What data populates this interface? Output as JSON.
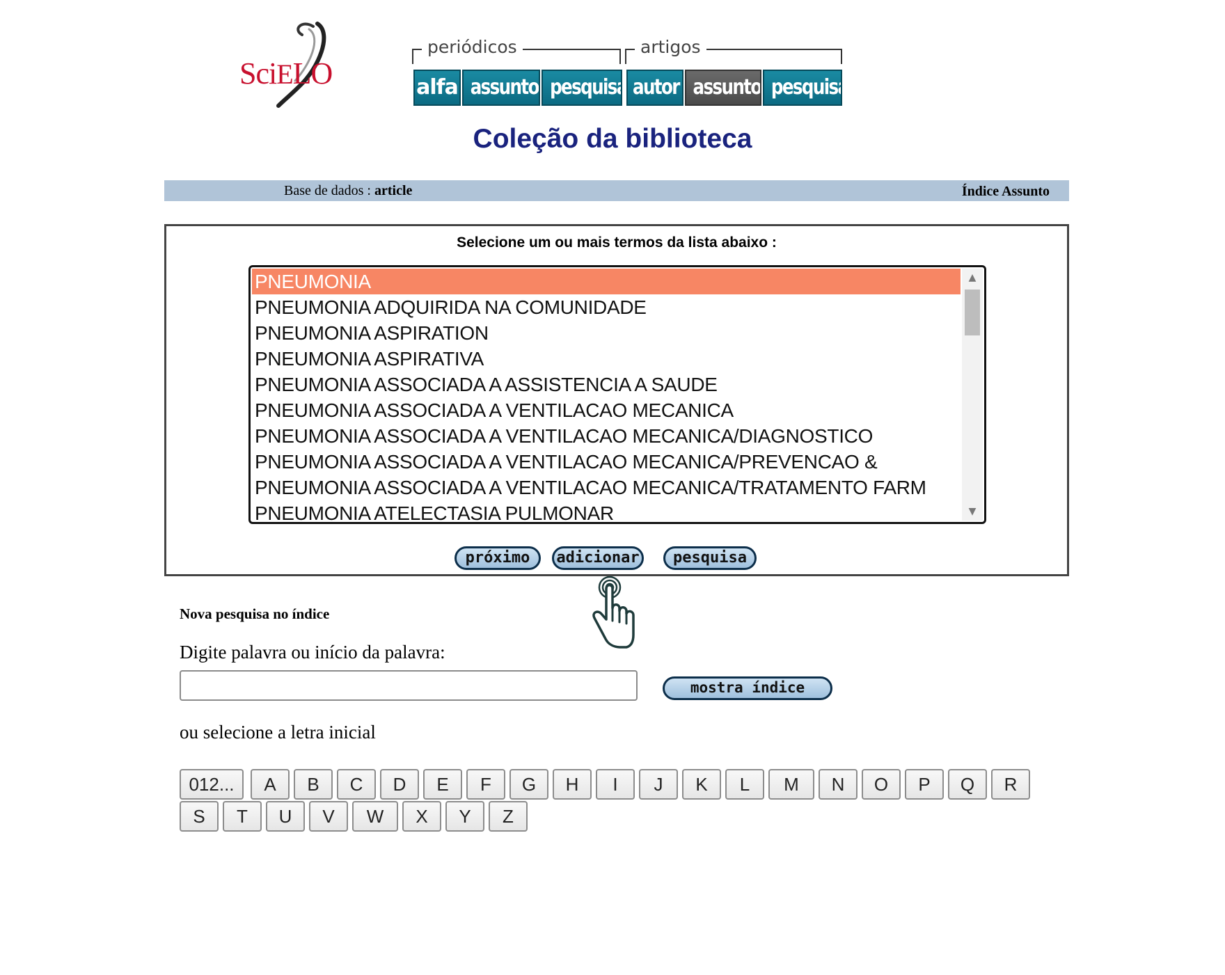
{
  "header": {
    "logo_main": "SciELO",
    "logo_prefix": "Sci",
    "logo_e": "E",
    "logo_suffix": "LO",
    "nav_groups": [
      {
        "label": "periódicos",
        "buttons": [
          {
            "label": "alfa",
            "active": false
          },
          {
            "label": "assunto",
            "active": false
          },
          {
            "label": "pesquisa",
            "active": false
          }
        ]
      },
      {
        "label": "artigos",
        "buttons": [
          {
            "label": "autor",
            "active": false
          },
          {
            "label": "assunto",
            "active": true
          },
          {
            "label": "pesquisa",
            "active": false
          }
        ]
      }
    ]
  },
  "page_title": "Coleção da biblioteca",
  "info_bar": {
    "db_label": "Base de dados :",
    "db_value": "article",
    "index_label": "Índice Assunto"
  },
  "select_panel": {
    "caption": "Selecione um ou mais termos da lista abaixo :",
    "terms": [
      {
        "label": "PNEUMONIA",
        "selected": true
      },
      {
        "label": "PNEUMONIA ADQUIRIDA NA COMUNIDADE",
        "selected": false
      },
      {
        "label": "PNEUMONIA ASPIRATION",
        "selected": false
      },
      {
        "label": "PNEUMONIA ASPIRATIVA",
        "selected": false
      },
      {
        "label": "PNEUMONIA ASSOCIADA A ASSISTENCIA A SAUDE",
        "selected": false
      },
      {
        "label": "PNEUMONIA ASSOCIADA A VENTILACAO MECANICA",
        "selected": false
      },
      {
        "label": "PNEUMONIA ASSOCIADA A VENTILACAO MECANICA/DIAGNOSTICO",
        "selected": false
      },
      {
        "label": "PNEUMONIA ASSOCIADA A VENTILACAO MECANICA/PREVENCAO &",
        "selected": false
      },
      {
        "label": "PNEUMONIA ASSOCIADA A VENTILACAO MECANICA/TRATAMENTO FARM",
        "selected": false
      },
      {
        "label": "PNEUMONIA ATELECTASIA PULMONAR",
        "selected": false
      }
    ],
    "buttons": {
      "next": "próximo",
      "add": "adicionar",
      "search": "pesquisa"
    }
  },
  "new_search": {
    "heading": "Nova pesquisa no índice",
    "prompt": "Digite palavra ou início da palavra:",
    "input_value": "",
    "show_index_button": "mostra índice",
    "letter_prompt": "ou selecione a letra inicial",
    "letter_rows": [
      [
        "012...",
        "A",
        "B",
        "C",
        "D",
        "E",
        "F",
        "G",
        "H",
        "I",
        "J",
        "K",
        "L",
        "M",
        "N",
        "O",
        "P",
        "Q",
        "R"
      ],
      [
        "S",
        "T",
        "U",
        "V",
        "W",
        "X",
        "Y",
        "Z"
      ]
    ]
  },
  "colors": {
    "title": "#1a237e",
    "info_bar": "#b0c4d8",
    "selected_term": "#f78664",
    "nav_button": "#0b6a82",
    "nav_button_active": "#4a4a4a",
    "logo": "#c8102e"
  }
}
